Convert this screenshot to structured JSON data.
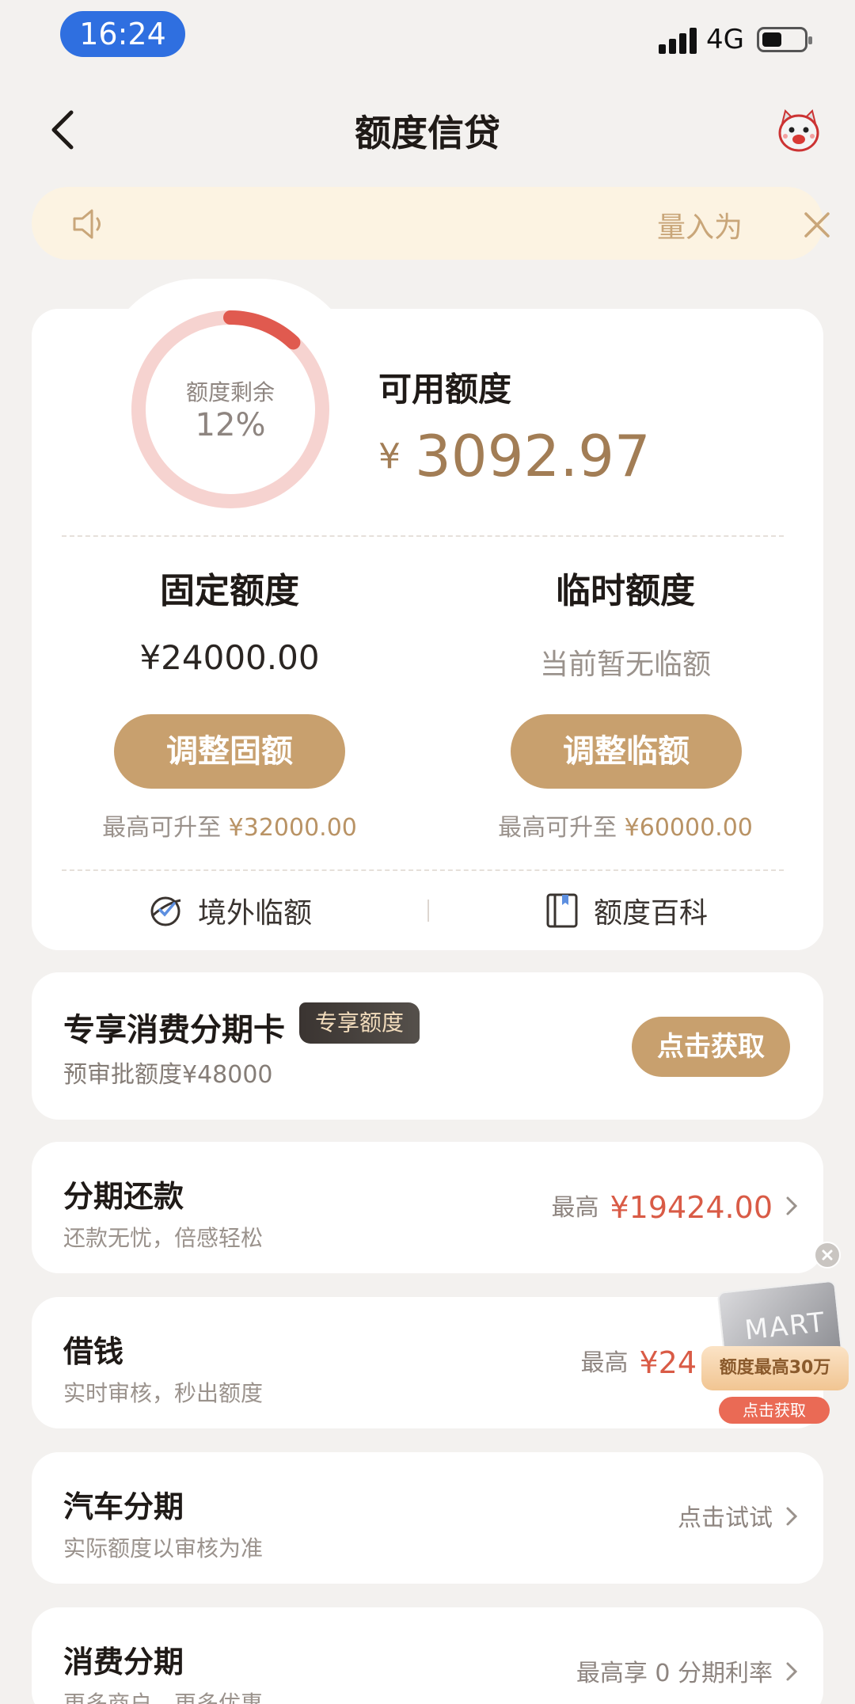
{
  "status_bar": {
    "time": "16:24",
    "network": "4G"
  },
  "nav": {
    "title": "额度信贷"
  },
  "notice": {
    "text": "量入为"
  },
  "credit": {
    "ring_label": "额度剩余",
    "ring_percent": "12%",
    "ring_fraction": 0.12,
    "available_label": "可用额度",
    "currency": "¥",
    "available_amount": "3092.97",
    "fixed": {
      "title": "固定额度",
      "value": "¥24000.00",
      "button": "调整固额",
      "note_prefix": "最高可升至",
      "note_amount": "¥32000.00"
    },
    "temp": {
      "title": "临时额度",
      "value": "当前暂无临额",
      "button": "调整临额",
      "note_prefix": "最高可升至",
      "note_amount": "¥60000.00"
    },
    "links": [
      {
        "label": "境外临额",
        "icon": "globe-plane-icon"
      },
      {
        "label": "额度百科",
        "icon": "book-icon"
      }
    ]
  },
  "colors": {
    "accent": "#c8a06e",
    "ring": "#e05a4f",
    "ring_track": "#f6d3d0",
    "amount_red": "#d95b46",
    "background": "#f3f1ef"
  },
  "promo": {
    "title": "专享消费分期卡",
    "badge": "专享额度",
    "subtitle": "预审批额度¥48000",
    "button": "点击获取"
  },
  "list": [
    {
      "title": "分期还款",
      "subtitle": "还款无忧，倍感轻松",
      "right_prefix": "最高",
      "right_amount": "¥19424.00"
    },
    {
      "title": "借钱",
      "subtitle": "实时审核，秒出额度",
      "right_prefix": "最高",
      "right_amount": "¥24"
    },
    {
      "title": "汽车分期",
      "subtitle": "实际额度以审核为准",
      "right_prefix": "点击试试",
      "right_amount": ""
    },
    {
      "title": "消费分期",
      "subtitle": "更多商户，更多优惠",
      "right_prefix": "最高享 0 分期利率",
      "right_amount": ""
    }
  ],
  "float_ad": {
    "card_word": "MART",
    "ribbon": "额度最高30万",
    "button": "点击获取"
  }
}
